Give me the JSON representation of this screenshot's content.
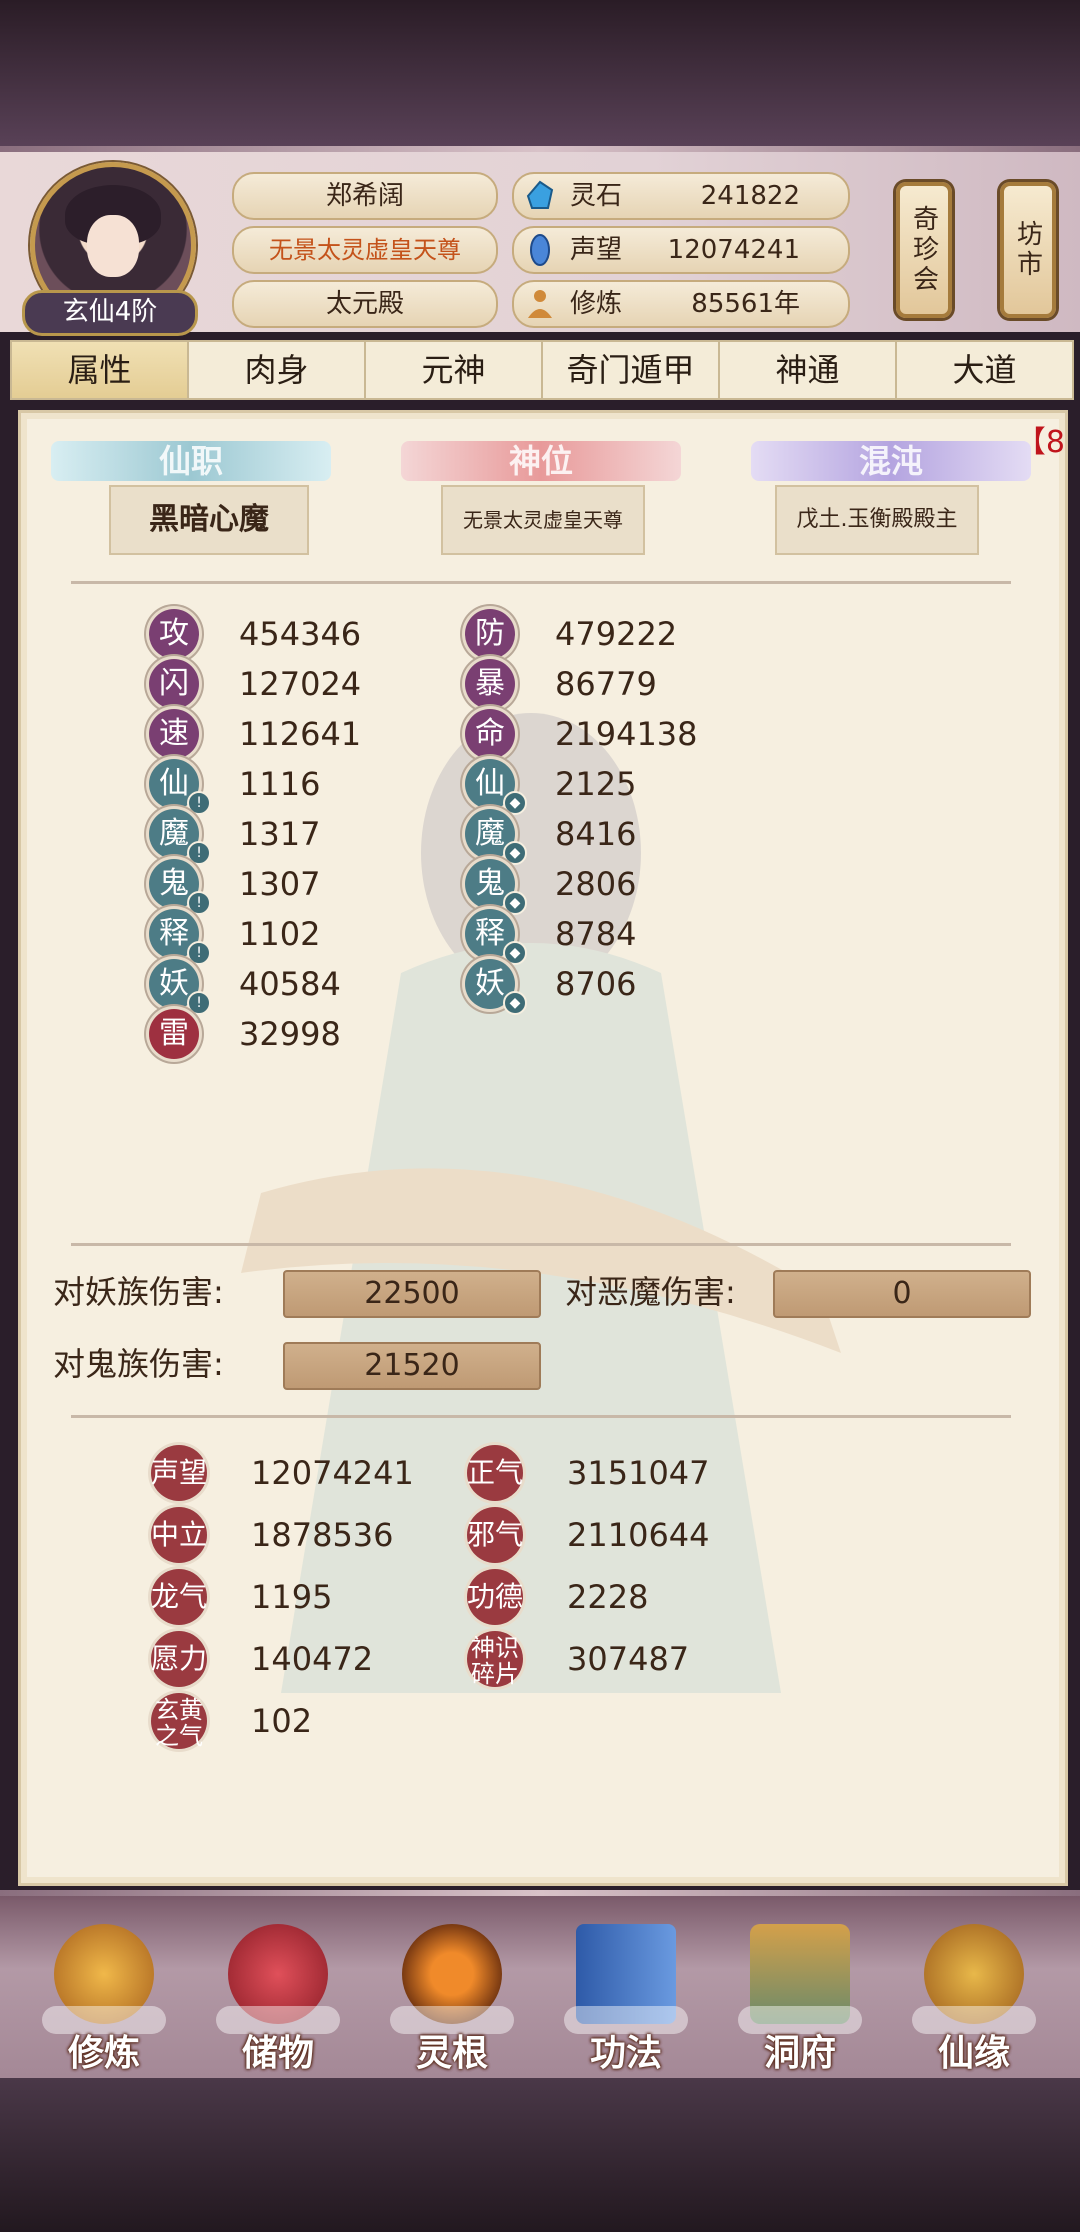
{
  "header": {
    "rank": "玄仙4阶",
    "name": "郑希阔",
    "title": "无景太灵虚皇天尊",
    "sect": "太元殿",
    "resources": [
      {
        "icon": "spirit-stone-icon",
        "label": "灵石",
        "value": "241822"
      },
      {
        "icon": "prestige-gem-icon",
        "label": "声望",
        "value": "12074241"
      },
      {
        "icon": "meditation-icon",
        "label": "修炼",
        "value": "85561年"
      }
    ],
    "side_buttons": [
      "奇珍会",
      "坊市"
    ]
  },
  "tabs": [
    "属性",
    "肉身",
    "元神",
    "奇门遁甲",
    "神通",
    "大道"
  ],
  "active_tab": 0,
  "positions": {
    "headers": [
      "仙职",
      "神位",
      "混沌"
    ],
    "values": [
      "黑暗心魔",
      "无景太灵虚皇天尊",
      "戊土.玉衡殿殿主"
    ],
    "badge": "【8"
  },
  "stats_left": [
    {
      "icon": "攻",
      "value": "454346",
      "style": "p"
    },
    {
      "icon": "闪",
      "value": "127024",
      "style": "p"
    },
    {
      "icon": "速",
      "value": "112641",
      "style": "p"
    },
    {
      "icon": "仙",
      "value": "1116",
      "style": "t"
    },
    {
      "icon": "魔",
      "value": "1317",
      "style": "t"
    },
    {
      "icon": "鬼",
      "value": "1307",
      "style": "t"
    },
    {
      "icon": "释",
      "value": "1102",
      "style": "t"
    },
    {
      "icon": "妖",
      "value": "40584",
      "style": "t"
    },
    {
      "icon": "雷",
      "value": "32998",
      "style": "r"
    }
  ],
  "stats_right": [
    {
      "icon": "防",
      "value": "479222",
      "style": "p"
    },
    {
      "icon": "暴",
      "value": "86779",
      "style": "p"
    },
    {
      "icon": "命",
      "value": "2194138",
      "style": "p"
    },
    {
      "icon": "仙",
      "value": "2125",
      "style": "t"
    },
    {
      "icon": "魔",
      "value": "8416",
      "style": "t"
    },
    {
      "icon": "鬼",
      "value": "2806",
      "style": "t"
    },
    {
      "icon": "释",
      "value": "8784",
      "style": "t"
    },
    {
      "icon": "妖",
      "value": "8706",
      "style": "t"
    }
  ],
  "damage": {
    "demon_label": "对妖族伤害:",
    "demon_value": "22500",
    "devil_label": "对恶魔伤害:",
    "devil_value": "0",
    "ghost_label": "对鬼族伤害:",
    "ghost_value": "21520"
  },
  "reputation_left": [
    {
      "icon": "声望",
      "value": "12074241"
    },
    {
      "icon": "中立",
      "value": "1878536"
    },
    {
      "icon": "龙气",
      "value": "1195"
    },
    {
      "icon": "愿力",
      "value": "140472"
    },
    {
      "icon": "玄黄之气",
      "value": "102"
    }
  ],
  "reputation_right": [
    {
      "icon": "正气",
      "value": "3151047"
    },
    {
      "icon": "邪气",
      "value": "2110644"
    },
    {
      "icon": "功德",
      "value": "2228"
    },
    {
      "icon": "神识碎片",
      "value": "307487"
    }
  ],
  "nav": [
    "修炼",
    "储物",
    "灵根",
    "功法",
    "洞府",
    "仙缘"
  ],
  "colors": {
    "accent": "#c0141c",
    "purple_icon": "#7a3f72",
    "teal_icon": "#4d7c86",
    "red_icon": "#9e3040"
  }
}
